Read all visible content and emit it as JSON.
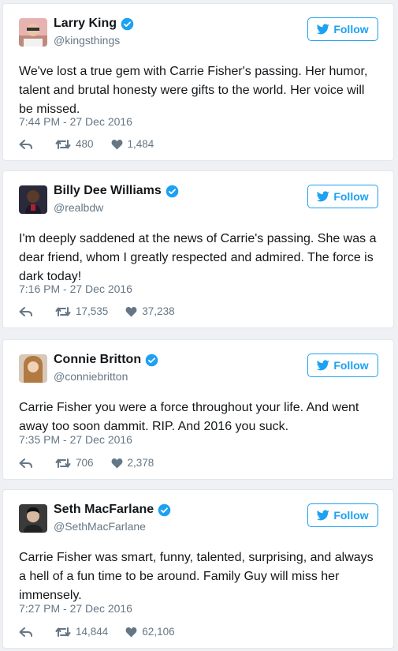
{
  "colors": {
    "accent": "#1da1f2",
    "muted": "#657786",
    "text": "#14171a"
  },
  "tweets": [
    {
      "name": "Larry King",
      "handle": "@kingsthings",
      "follow": "Follow",
      "text": "We've lost a true gem with Carrie Fisher's passing. Her humor, talent and brutal honesty were gifts to the world. Her voice will be missed.",
      "date": "7:44 PM - 27 Dec 2016",
      "retweets": "480",
      "likes": "1,484"
    },
    {
      "name": "Billy Dee Williams",
      "handle": "@realbdw",
      "follow": "Follow",
      "text": "I'm deeply saddened at the news of Carrie's passing. She was a dear friend, whom I greatly respected and admired. The force is dark today!",
      "date": "7:16 PM - 27 Dec 2016",
      "retweets": "17,535",
      "likes": "37,238"
    },
    {
      "name": "Connie Britton",
      "handle": "@conniebritton",
      "follow": "Follow",
      "text": "Carrie Fisher you were a force throughout your life. And went away too soon dammit. RIP. And 2016 you suck.",
      "date": "7:35 PM - 27 Dec 2016",
      "retweets": "706",
      "likes": "2,378"
    },
    {
      "name": "Seth MacFarlane",
      "handle": "@SethMacFarlane",
      "follow": "Follow",
      "text": "Carrie Fisher was smart, funny, talented, surprising, and always a hell of a fun time to be around. Family Guy will miss her immensely.",
      "date": "7:27 PM - 27 Dec 2016",
      "retweets": "14,844",
      "likes": "62,106"
    }
  ]
}
